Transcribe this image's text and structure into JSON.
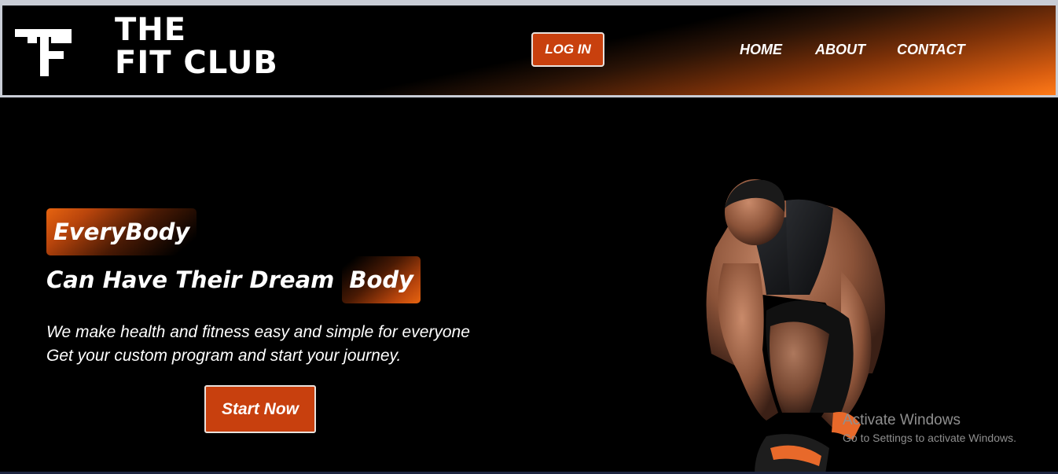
{
  "navbar": {
    "brand_line1": "THE",
    "brand_line2": "FIT CLUB",
    "logo_icon": "tf-logo-icon",
    "login_label": "LOG IN",
    "links": [
      {
        "label": "HOME"
      },
      {
        "label": "ABOUT"
      },
      {
        "label": "CONTACT"
      }
    ],
    "accent_color": "#ff7a18",
    "button_color": "#c8400e"
  },
  "hero": {
    "tag_everybody": "EveryBody",
    "headline_text": "Can Have Their Dream",
    "tag_body": "Body",
    "description_line1": "We make health and fitness easy and simple for everyone",
    "description_line2": "Get your custom program and start your journey.",
    "cta_label": "Start Now",
    "image": "athlete-tying-shoe"
  },
  "watermark": {
    "title": "Activate Windows",
    "subtitle": "Go to Settings to activate Windows."
  }
}
